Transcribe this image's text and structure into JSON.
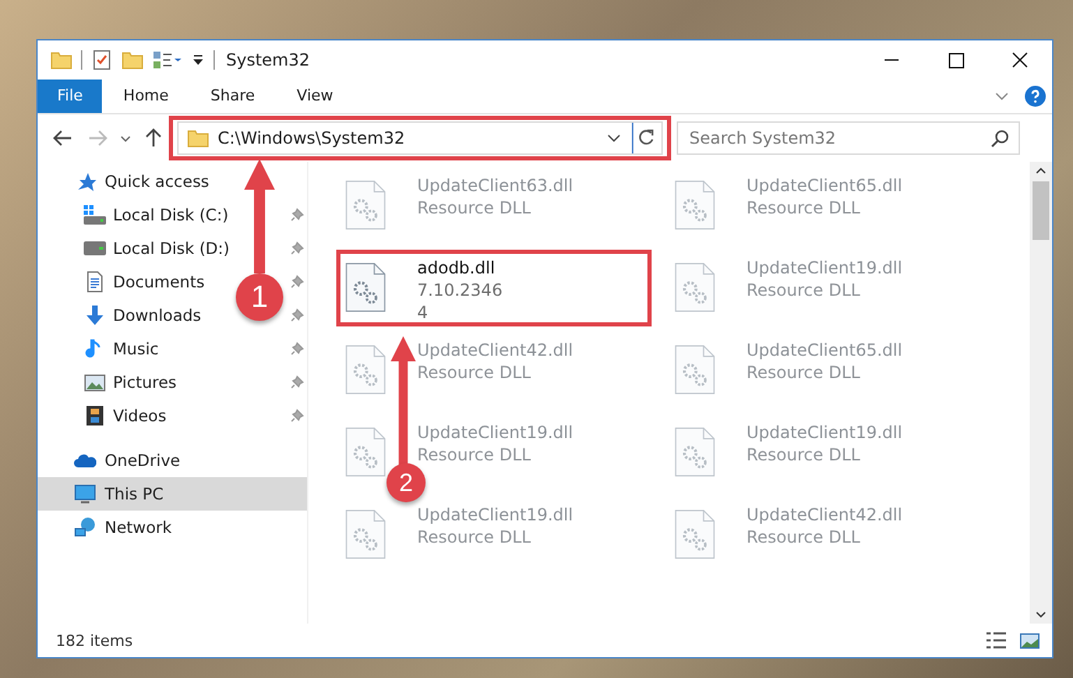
{
  "window": {
    "title": "System32"
  },
  "ribbon": {
    "tabs": [
      {
        "label": "File",
        "kind": "file"
      },
      {
        "label": "Home",
        "kind": "tab"
      },
      {
        "label": "Share",
        "kind": "tab"
      },
      {
        "label": "View",
        "kind": "tab"
      }
    ]
  },
  "address_bar": {
    "path": "C:\\Windows\\System32",
    "highlighted": true
  },
  "search": {
    "placeholder": "Search System32"
  },
  "nav": {
    "items": [
      {
        "label": "Quick access",
        "kind": "star",
        "selected": false,
        "children": [
          {
            "label": "Local Disk (C:)",
            "kind": "drive-c",
            "pinned": true
          },
          {
            "label": "Local Disk (D:)",
            "kind": "drive",
            "pinned": true
          },
          {
            "label": "Documents",
            "kind": "documents",
            "pinned": true
          },
          {
            "label": "Downloads",
            "kind": "downloads",
            "pinned": true
          },
          {
            "label": "Music",
            "kind": "music",
            "pinned": true
          },
          {
            "label": "Pictures",
            "kind": "pictures",
            "pinned": true
          },
          {
            "label": "Videos",
            "kind": "videos",
            "pinned": true
          }
        ]
      },
      {
        "label": "OneDrive",
        "kind": "cloud",
        "selected": false
      },
      {
        "label": "This PC",
        "kind": "pc",
        "selected": true
      },
      {
        "label": "Network",
        "kind": "network",
        "selected": false
      }
    ]
  },
  "files": [
    {
      "name": "UpdateClient63.dll",
      "details": [
        "Resource DLL"
      ],
      "blurred": true,
      "highlighted": false
    },
    {
      "name": "UpdateClient65.dll",
      "details": [
        "Resource DLL"
      ],
      "blurred": true,
      "highlighted": false
    },
    {
      "name": "adodb.dll",
      "details": [
        "7.10.2346",
        "4"
      ],
      "blurred": false,
      "highlighted": true
    },
    {
      "name": "UpdateClient19.dll",
      "details": [
        "Resource DLL"
      ],
      "blurred": true,
      "highlighted": false
    },
    {
      "name": "UpdateClient42.dll",
      "details": [
        "Resource DLL"
      ],
      "blurred": true,
      "highlighted": false
    },
    {
      "name": "UpdateClient65.dll",
      "details": [
        "Resource DLL"
      ],
      "blurred": true,
      "highlighted": false
    },
    {
      "name": "UpdateClient19.dll",
      "details": [
        "Resource DLL"
      ],
      "blurred": true,
      "highlighted": false
    },
    {
      "name": "UpdateClient19.dll",
      "details": [
        "Resource DLL"
      ],
      "blurred": true,
      "highlighted": false
    },
    {
      "name": "UpdateClient19.dll",
      "details": [
        "Resource DLL"
      ],
      "blurred": true,
      "highlighted": false
    },
    {
      "name": "UpdateClient42.dll",
      "details": [
        "Resource DLL"
      ],
      "blurred": true,
      "highlighted": false
    }
  ],
  "status_bar": {
    "count": "182 items"
  },
  "callouts": [
    {
      "number": "1"
    },
    {
      "number": "2"
    }
  ]
}
